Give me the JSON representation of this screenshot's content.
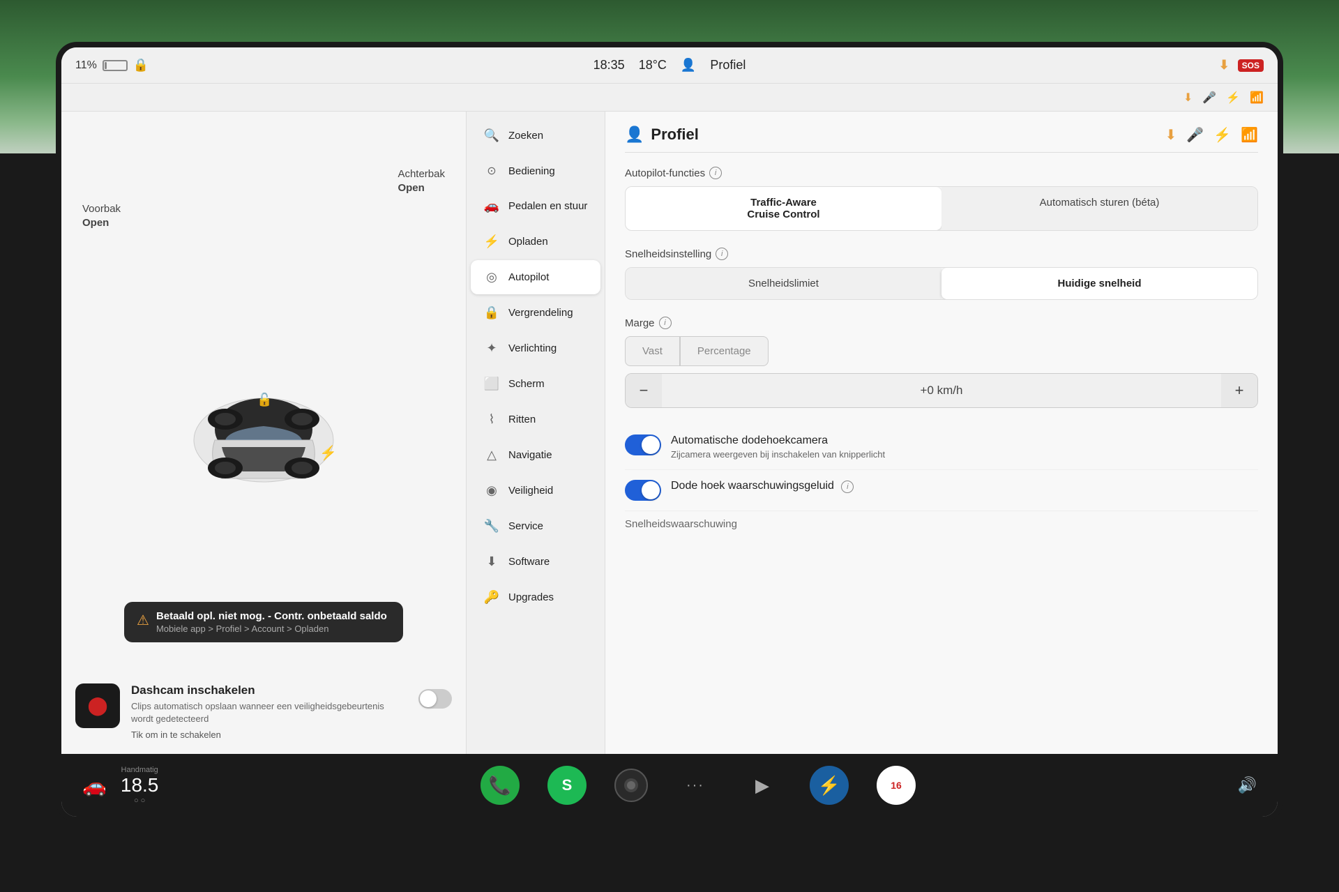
{
  "bg": {
    "color": "#4a7c4e"
  },
  "statusBar": {
    "battery": "11%",
    "lock_icon": "🔒",
    "time": "18:35",
    "temperature": "18°C",
    "profile_icon": "👤",
    "profile_label": "Profiel",
    "download_icon": "⬇",
    "mic_icon": "🎤",
    "bluetooth_icon": "🔵",
    "signal_icon": "📶"
  },
  "carDisplay": {
    "voorbak_label": "Voorbak",
    "voorbak_status": "Open",
    "achterbak_label": "Achterbak",
    "achterbak_status": "Open"
  },
  "warning": {
    "title": "Betaald opl. niet mog. - Contr. onbetaald saldo",
    "subtitle": "Mobiele app > Profiel > Account > Opladen"
  },
  "dashcam": {
    "title": "Dashcam inschakelen",
    "description": "Clips automatisch opslaan wanneer een veiligheidsgebeurtenis wordt gedetecteerd",
    "link": "Tik om in te schakelen",
    "enabled": false
  },
  "menu": {
    "items": [
      {
        "id": "zoeken",
        "label": "Zoeken",
        "icon": "🔍"
      },
      {
        "id": "bediening",
        "label": "Bediening",
        "icon": "🎮"
      },
      {
        "id": "pedalen",
        "label": "Pedalen en stuur",
        "icon": "🚗"
      },
      {
        "id": "opladen",
        "label": "Opladen",
        "icon": "⚡"
      },
      {
        "id": "autopilot",
        "label": "Autopilot",
        "icon": "🎯",
        "active": true
      },
      {
        "id": "vergrendeling",
        "label": "Vergrendeling",
        "icon": "🔒"
      },
      {
        "id": "verlichting",
        "label": "Verlichting",
        "icon": "💡"
      },
      {
        "id": "scherm",
        "label": "Scherm",
        "icon": "🖥"
      },
      {
        "id": "ritten",
        "label": "Ritten",
        "icon": "📊"
      },
      {
        "id": "navigatie",
        "label": "Navigatie",
        "icon": "🗺"
      },
      {
        "id": "veiligheid",
        "label": "Veiligheid",
        "icon": "🛡"
      },
      {
        "id": "service",
        "label": "Service",
        "icon": "🔧"
      },
      {
        "id": "software",
        "label": "Software",
        "icon": "⬇"
      },
      {
        "id": "upgrades",
        "label": "Upgrades",
        "icon": "🔑"
      }
    ]
  },
  "rightPanel": {
    "title": "Profiel",
    "title_icon": "👤",
    "sections": {
      "autopilot": {
        "label": "Autopilot-functies",
        "options": [
          "Traffic-Aware Cruise Control",
          "Automatisch sturen (béta)"
        ],
        "selected": 0
      },
      "snelheid": {
        "label": "Snelheidsinstelling",
        "options": [
          "Snelheidslimiet",
          "Huidige snelheid"
        ],
        "selected": 1
      },
      "marge": {
        "label": "Marge",
        "options": [
          "Vast",
          "Percentage"
        ],
        "speed_value": "+0 km/h"
      },
      "dodehoekcamera": {
        "title": "Automatische dodehoekcamera",
        "description": "Zijcamera weergeven bij inschakelen van knipperlicht",
        "enabled": true
      },
      "dodehoek_geluid": {
        "title": "Dode hoek waarschuwingsgeluid",
        "enabled": true
      },
      "snelheidswaarschuwing": {
        "label": "Snelheidswaarschuwing"
      }
    }
  },
  "taskbar": {
    "car_icon": "🚗",
    "temp_label": "Handmatig",
    "temp_value": "18.5",
    "buttons": [
      {
        "id": "phone",
        "icon": "📞",
        "style": "phone"
      },
      {
        "id": "spotify",
        "icon": "♪",
        "style": "spotify"
      },
      {
        "id": "voice",
        "icon": "○",
        "style": "voice"
      },
      {
        "id": "dots",
        "icon": "···",
        "style": "dots"
      },
      {
        "id": "media",
        "icon": "▶",
        "style": "media"
      },
      {
        "id": "bluetooth",
        "icon": "⚡",
        "style": "bluetooth"
      },
      {
        "id": "calendar",
        "icon": "16",
        "style": "calendar"
      }
    ],
    "volume_icon": "🔊"
  }
}
